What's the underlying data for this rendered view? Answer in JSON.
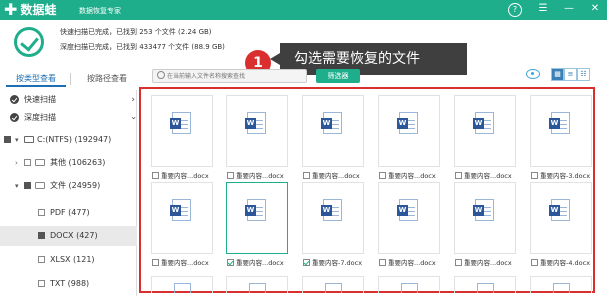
{
  "app": {
    "name": "数据蛙",
    "subtitle": "数据恢复专家"
  },
  "scan": {
    "quick_line": "快速扫描已完成，已找到 253 个文件 (2.24 GB)",
    "deep_line": "深度扫描已完成，已找到 433477 个文件 (88.9 GB)"
  },
  "callout": {
    "step": "1",
    "text": "勾选需要恢复的文件"
  },
  "tabs": [
    {
      "label": "按类型查看",
      "active": true
    },
    {
      "label": "按路径查看",
      "active": false
    }
  ],
  "search": {
    "placeholder": "在当前输入文件名称搜索查找",
    "filter_label": "筛选器"
  },
  "sidebar": {
    "quick_scan": "快速扫描",
    "deep_scan": "深度扫描",
    "drive": "C:(NTFS) (192947)",
    "other": "其他 (106263)",
    "documents": "文件 (24959)",
    "pdf": "PDF (477)",
    "docx": "DOCX (427)",
    "xlsx": "XLSX (121)",
    "txt": "TXT (988)"
  },
  "files": [
    {
      "name": "重要内容...docx",
      "checked": false
    },
    {
      "name": "重要内容...docx",
      "checked": false
    },
    {
      "name": "重要内容...docx",
      "checked": false
    },
    {
      "name": "重要内容...docx",
      "checked": false
    },
    {
      "name": "重要内容...docx",
      "checked": false
    },
    {
      "name": "重要内容-3.docx",
      "checked": false
    },
    {
      "name": "重要内容...docx",
      "checked": false
    },
    {
      "name": "重要内容...docx",
      "checked": true
    },
    {
      "name": "重要内容-7.docx",
      "checked": true
    },
    {
      "name": "重要内容...docx",
      "checked": false
    },
    {
      "name": "重要内容...docx",
      "checked": false
    },
    {
      "name": "重要内容-4.docx",
      "checked": false
    }
  ],
  "icons": {
    "word": "W"
  },
  "colors": {
    "brand": "#1fae8c",
    "highlight": "#d9302f"
  }
}
